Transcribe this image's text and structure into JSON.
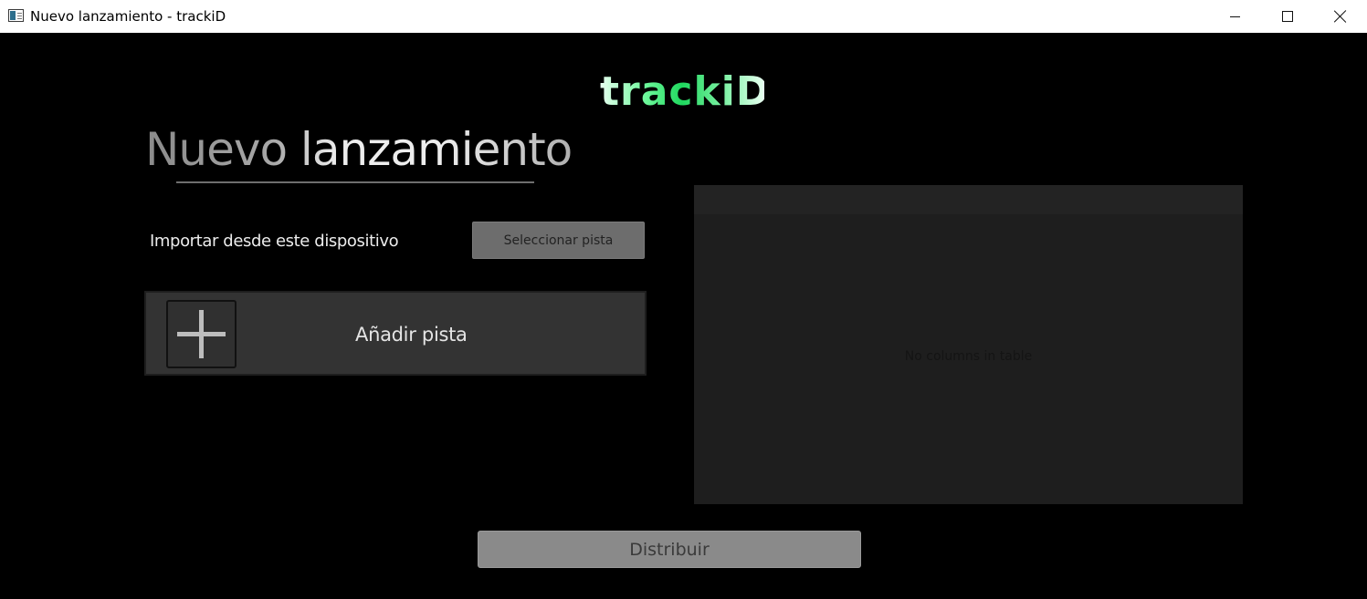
{
  "window": {
    "title": "Nuevo lanzamiento - trackiD",
    "icon": "app-window-icon",
    "controls": [
      "minimize-icon",
      "maximize-icon",
      "close-icon"
    ]
  },
  "logo": {
    "text": "trackiD",
    "colors": [
      "#e8fff0",
      "#1fd85e"
    ]
  },
  "page": {
    "title": "Nuevo lanzamiento"
  },
  "import": {
    "label": "Importar desde este dispositivo",
    "button_label": "Seleccionar pista"
  },
  "add_track": {
    "icon": "plus-icon",
    "label": "Añadir pista"
  },
  "table": {
    "empty_message": "No columns in table"
  },
  "footer": {
    "distribute_label": "Distribuir"
  },
  "colors": {
    "background": "#000000",
    "panel": "#333333",
    "table": "#1e1e1e",
    "button": "#6d6d6d",
    "primary_button": "#8a8a8a"
  }
}
